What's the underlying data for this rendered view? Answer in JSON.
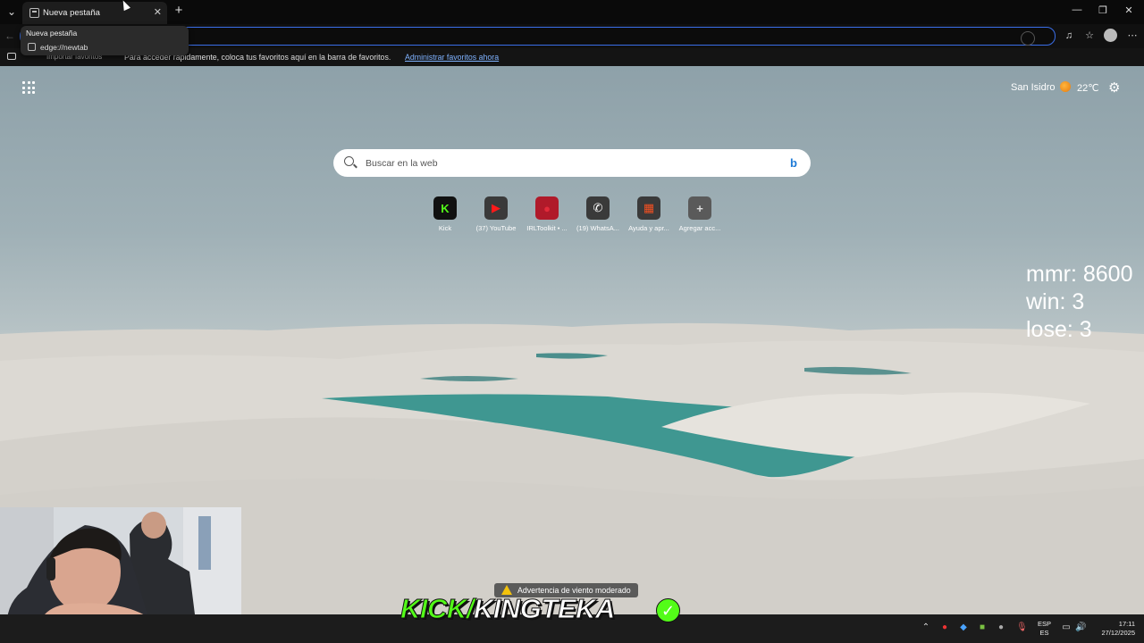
{
  "browser": {
    "tab_title": "Nueva pestaña",
    "tab_close": "✕",
    "new_tab": "+",
    "hover_card": {
      "title": "Nueva pestaña",
      "url": "edge://newtab"
    },
    "window_controls": {
      "minimize": "—",
      "restore": "❐",
      "close": "✕"
    }
  },
  "favorites_bar": {
    "import_label": "Importar favoritos",
    "message": "Para acceder rápidamente, coloca tus favoritos aquí en la barra de favoritos.",
    "manage_link": "Administrar favoritos ahora"
  },
  "new_tab_page": {
    "weather": {
      "location": "San Isidro",
      "temperature": "22℃"
    },
    "search": {
      "placeholder": "Buscar en la web",
      "engine_icon": "bing-icon"
    },
    "quick_links": [
      {
        "label": "Kick",
        "glyph": "K",
        "bg": "#111111",
        "fg": "#53fc18"
      },
      {
        "label": "(37) YouTube",
        "glyph": "▶",
        "bg": "#3a3a3a",
        "fg": "#ff1a1a"
      },
      {
        "label": "IRLToolkit • ...",
        "glyph": "●",
        "bg": "#b01a2a",
        "fg": "#e22a3a"
      },
      {
        "label": "(19) WhatsA...",
        "glyph": "✆",
        "bg": "#3a3a3a",
        "fg": "#ffffff"
      },
      {
        "label": "Ayuda y apr...",
        "glyph": "▦",
        "bg": "#3a3a3a",
        "fg": "#f25022"
      },
      {
        "label": "Agregar acc...",
        "glyph": "+",
        "bg": "#5a5a5a",
        "fg": "#dddddd"
      }
    ]
  },
  "stream_overlay": {
    "stats": {
      "mmr": "mmr: 8600",
      "win": "win: 3",
      "lose": "lose: 3"
    },
    "alert": "Advertencia de viento moderado",
    "kick_prefix": "KICK/",
    "kick_channel": "KINGTEKA",
    "verified_glyph": "✓"
  },
  "taskbar": {
    "lang_primary": "ESP",
    "lang_secondary": "ES",
    "time": "17:11",
    "date": "27/12/2025"
  },
  "colors": {
    "accent_blue": "#3a6ee8",
    "kick_green": "#53fc18",
    "water": "#2e8f8a"
  }
}
